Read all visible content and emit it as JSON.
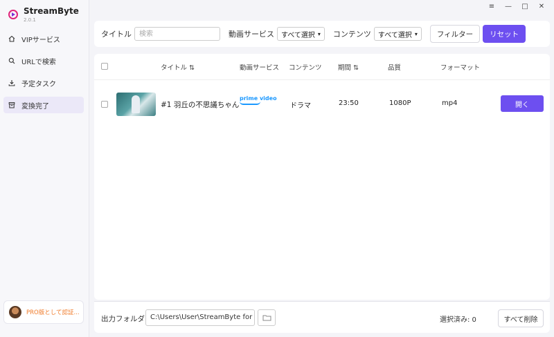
{
  "app": {
    "name": "StreamByte",
    "version": "2.0.1"
  },
  "window_controls": {
    "menu": "≡",
    "minimize": "—",
    "maximize": "□",
    "close": "✕"
  },
  "sidebar": {
    "items": [
      {
        "label": "VIPサービス",
        "icon": "home-icon",
        "active": false
      },
      {
        "label": "URLで検索",
        "icon": "search-icon",
        "active": false
      },
      {
        "label": "予定タスク",
        "icon": "download-icon",
        "active": false
      },
      {
        "label": "変換完了",
        "icon": "archive-icon",
        "active": true
      }
    ],
    "pro_text": "PRO版として認証..."
  },
  "filter": {
    "title_label": "タイトル",
    "search_placeholder": "検索",
    "service_label": "動画サービス",
    "service_value": "すべて選択",
    "content_label": "コンテンツ",
    "content_value": "すべて選択",
    "filter_button": "フィルター",
    "reset_button": "リセット"
  },
  "table": {
    "headers": {
      "title": "タイトル",
      "service": "動画サービス",
      "content": "コンテンツ",
      "duration": "期間",
      "quality": "品質",
      "format": "フォーマット"
    },
    "rows": [
      {
        "title": "#1 羽丘の不思議ちゃん",
        "service_logo": "prime video",
        "content": "ドラマ",
        "duration": "23:50",
        "quality": "1080P",
        "format": "mp4",
        "action": "開く"
      }
    ]
  },
  "footer": {
    "output_label": "出力フォルダ",
    "output_path": "C:\\Users\\User\\StreamByte for",
    "selected_text": "選択済み: 0",
    "delete_all": "すべて削除"
  },
  "colors": {
    "accent": "#6d4ff0",
    "pro": "#f07b2a",
    "prime": "#1a98ff"
  }
}
